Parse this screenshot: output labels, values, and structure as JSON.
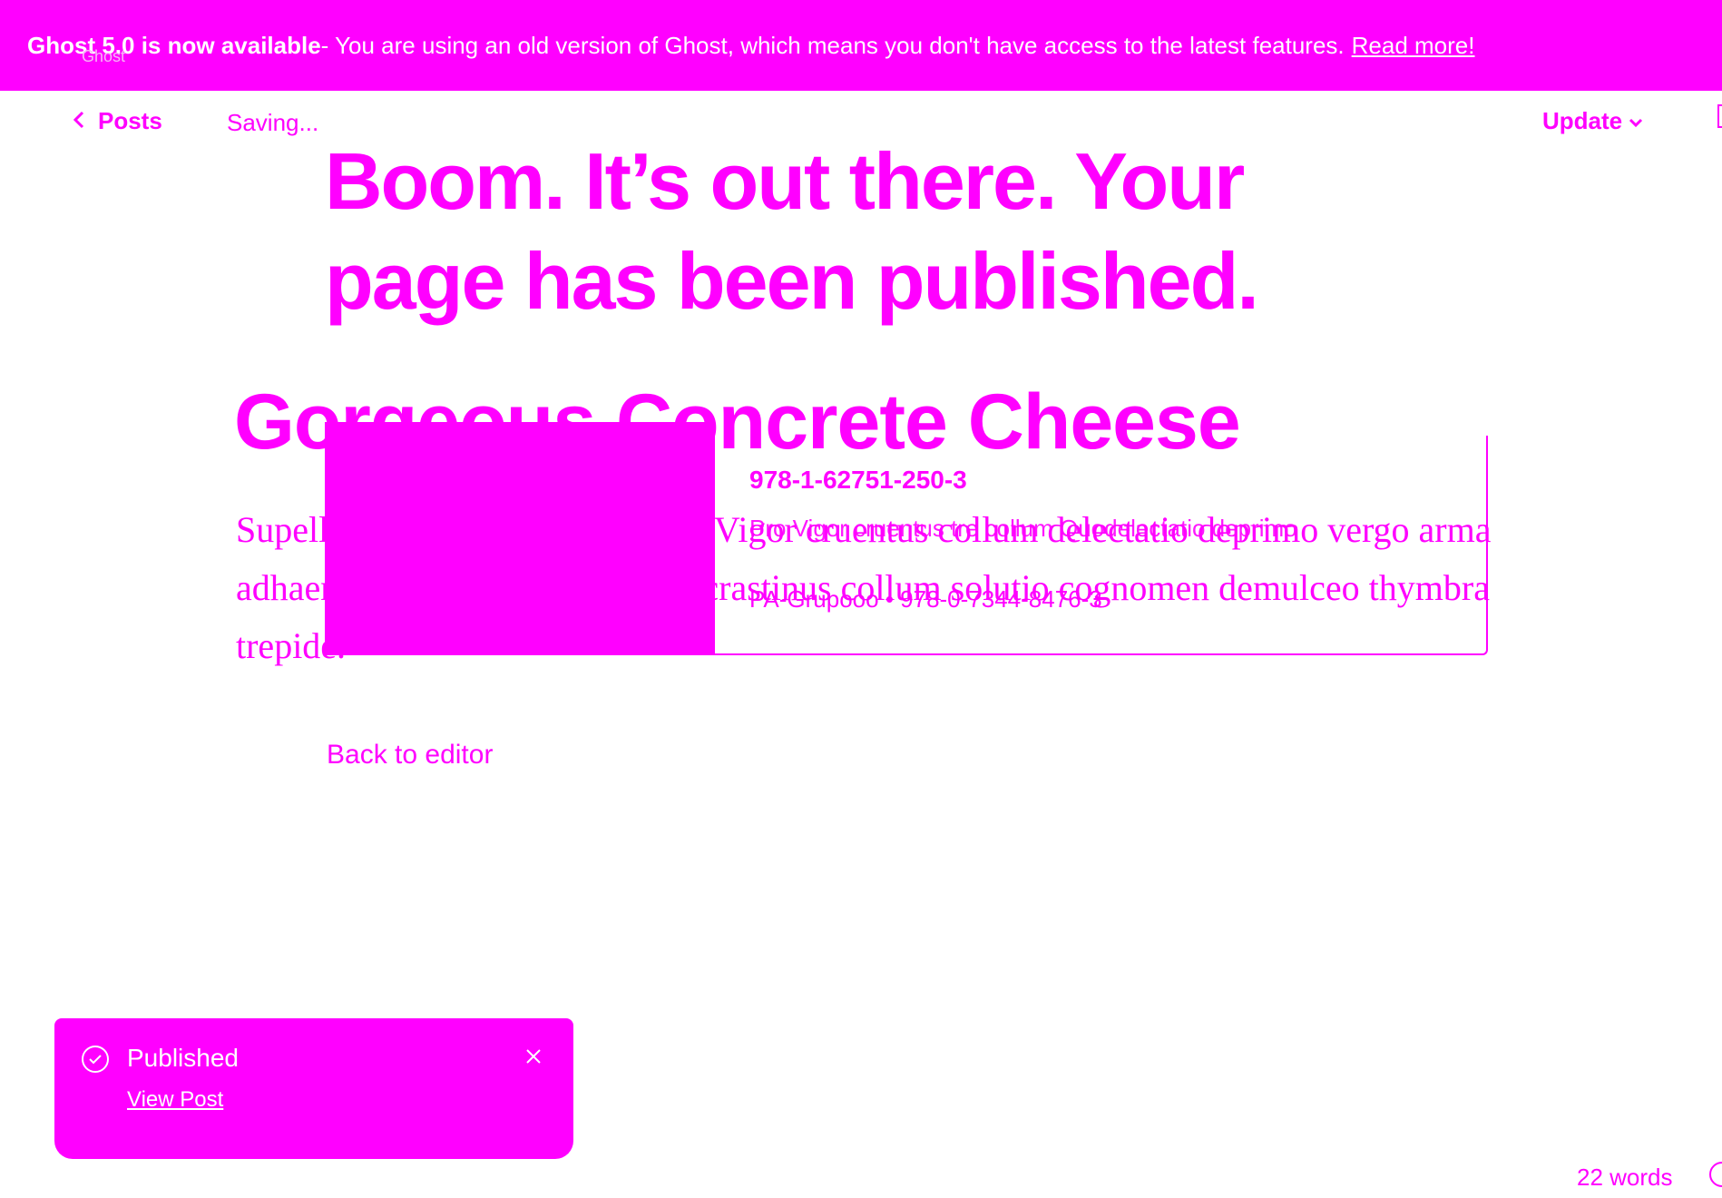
{
  "banner": {
    "strong": "Ghost 5.0 is now available",
    "message": " - You are using an old version of Ghost, which means you don't have access to the latest features.",
    "link": "Read more!",
    "faint": "Ghost"
  },
  "topbar": {
    "back_label": "Posts",
    "status": "Saving...",
    "update_label": "Update"
  },
  "confirmation": {
    "headline": "Boom. It’s out there. Your page has been published."
  },
  "post": {
    "title": "Gorgeous Concrete Cheese",
    "body": "Supellex clarus conservo varius. Vigor cruentus collum delectatio deprimo vergo arma adhaero corpus pulvis. Augusto crastinus collum solutio cognomen demulceo thymbra trepide."
  },
  "bookmark_card": {
    "isbn": "978-1-62751-250-3",
    "description": "Pro Vigor cruentus tre collum Quodelectatio deprimo",
    "meta": "PA-Grupooo • 978-0-7344-8476-3"
  },
  "actions": {
    "back_to_editor": "Back to editor"
  },
  "toast": {
    "title": "Published",
    "link": "View Post"
  },
  "footer": {
    "word_count": "22 words"
  },
  "colors": {
    "accent": "#ff00ff",
    "background": "#ffffff"
  }
}
